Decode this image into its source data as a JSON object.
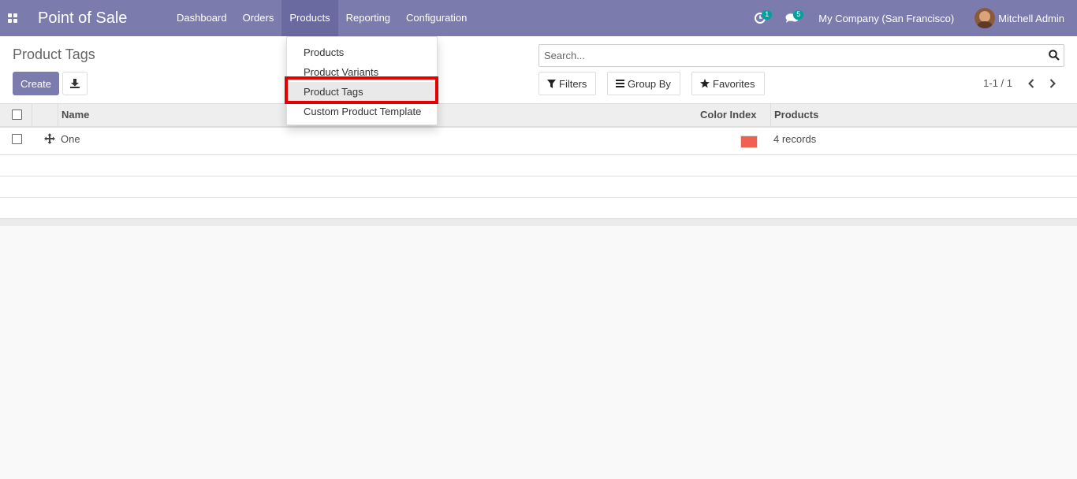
{
  "navbar": {
    "brand": "Point of Sale",
    "menu": [
      "Dashboard",
      "Orders",
      "Products",
      "Reporting",
      "Configuration"
    ],
    "activity_count": "1",
    "messages_count": "5",
    "company": "My Company (San Francisco)",
    "user": "Mitchell Admin",
    "accent_color": "#7c7bad"
  },
  "control": {
    "title": "Product Tags",
    "create_label": "Create",
    "search_placeholder": "Search...",
    "filters_label": "Filters",
    "groupby_label": "Group By",
    "favorites_label": "Favorites",
    "pager": "1-1 / 1"
  },
  "table": {
    "columns": [
      "Name",
      "Color Index",
      "Products"
    ],
    "rows": [
      {
        "name": "One",
        "color": "#f06050",
        "products": "4 records"
      }
    ]
  },
  "dropdown": {
    "items": [
      "Products",
      "Product Variants",
      "Product Tags",
      "Custom Product Template"
    ],
    "highlighted": "Product Tags"
  }
}
